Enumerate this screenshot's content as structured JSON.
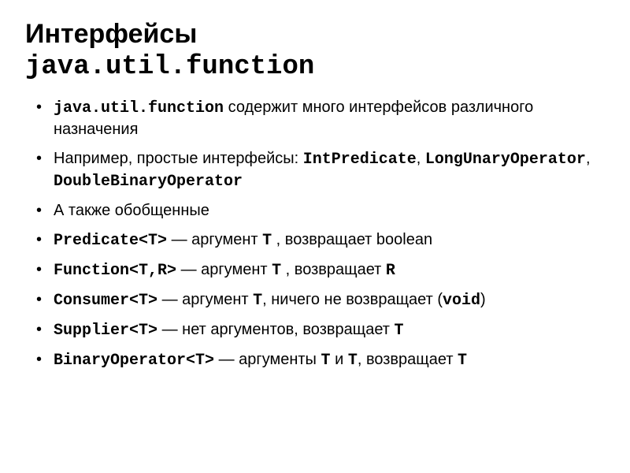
{
  "title": {
    "line1": "Интерфейсы",
    "line2_code": "java.util.function"
  },
  "items": [
    {
      "parts": [
        {
          "text": "java.util.function",
          "mono": true,
          "bold": true
        },
        {
          "text": " содержит много интерфейсов различного назначения"
        }
      ]
    },
    {
      "parts": [
        {
          "text": "Например, простые интерфейсы: "
        },
        {
          "text": "IntPredicate",
          "mono": true,
          "bold": true
        },
        {
          "text": ", "
        },
        {
          "text": "LongUnaryOperator",
          "mono": true,
          "bold": true
        },
        {
          "text": ", "
        },
        {
          "text": "DoubleBinaryOperator",
          "mono": true,
          "bold": true
        }
      ]
    },
    {
      "parts": [
        {
          "text": "А также обобщенные"
        }
      ]
    },
    {
      "parts": [
        {
          "text": "Predicate<T>",
          "mono": true,
          "bold": true
        },
        {
          "text": " — аргумент "
        },
        {
          "text": "T",
          "mono": true,
          "bold": true
        },
        {
          "text": " , возвращает boolean"
        }
      ]
    },
    {
      "parts": [
        {
          "text": "Function<T,R>",
          "mono": true,
          "bold": true
        },
        {
          "text": " — аргумент "
        },
        {
          "text": "T",
          "mono": true,
          "bold": true
        },
        {
          "text": " , возвращает "
        },
        {
          "text": "R",
          "mono": true,
          "bold": true
        }
      ]
    },
    {
      "parts": [
        {
          "text": "Consumer<T>",
          "mono": true,
          "bold": true
        },
        {
          "text": " — аргумент "
        },
        {
          "text": "T",
          "mono": true,
          "bold": true
        },
        {
          "text": ", ничего не возвращает ("
        },
        {
          "text": "void",
          "mono": true,
          "bold": true
        },
        {
          "text": ")"
        }
      ]
    },
    {
      "parts": [
        {
          "text": "Supplier<T>",
          "mono": true,
          "bold": true
        },
        {
          "text": " — нет аргументов, возвращает "
        },
        {
          "text": "T",
          "mono": true,
          "bold": true
        }
      ]
    },
    {
      "parts": [
        {
          "text": "BinaryOperator<T>",
          "mono": true,
          "bold": true
        },
        {
          "text": " — аргументы "
        },
        {
          "text": "T",
          "mono": true,
          "bold": true
        },
        {
          "text": " и "
        },
        {
          "text": "T",
          "mono": true,
          "bold": true
        },
        {
          "text": ", возвращает "
        },
        {
          "text": "T",
          "mono": true,
          "bold": true
        }
      ]
    }
  ]
}
